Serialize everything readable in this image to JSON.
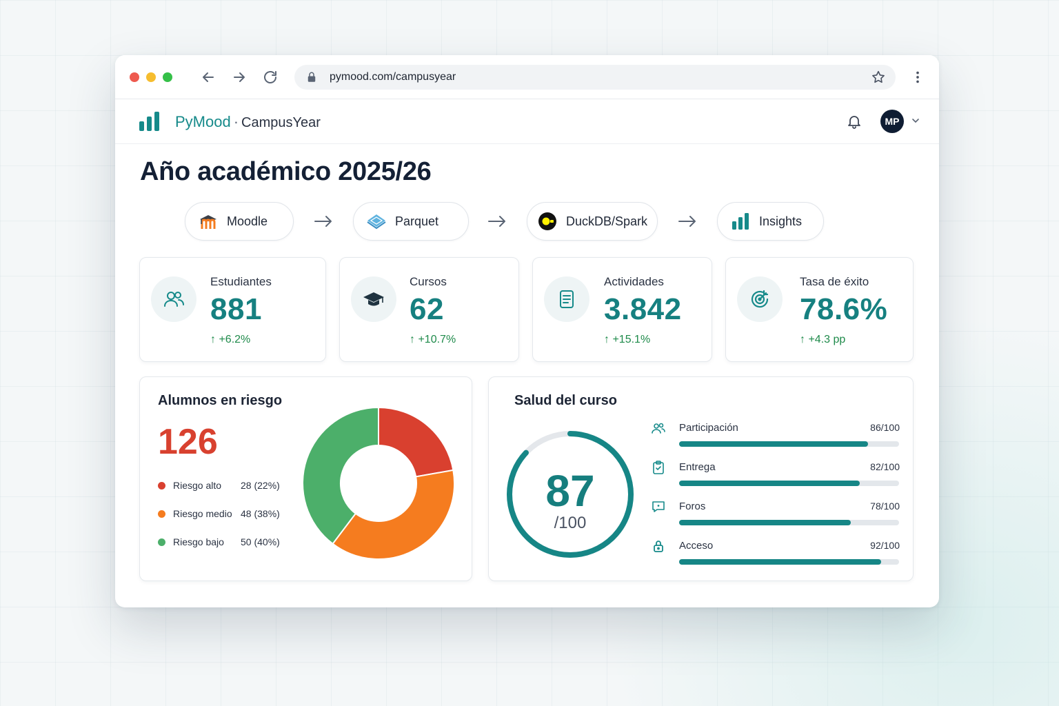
{
  "browser": {
    "url": "pymood.com/campusyear"
  },
  "app": {
    "brand_name": "PyMood",
    "brand_sep": "·",
    "brand_sub": "CampusYear",
    "user_initials": "MP"
  },
  "page": {
    "title": "Año académico 2025/26"
  },
  "pipeline": [
    {
      "label": "Moodle",
      "icon": "moodle-logo-icon"
    },
    {
      "label": "Parquet",
      "icon": "parquet-logo-icon"
    },
    {
      "label": "DuckDB/Spark",
      "icon": "duckdb-logo-icon"
    },
    {
      "label": "Insights",
      "icon": "bar-chart-icon"
    }
  ],
  "kpis": [
    {
      "label": "Estudiantes",
      "value": "881",
      "delta": "+6.2%",
      "icon": "users-icon"
    },
    {
      "label": "Cursos",
      "value": "62",
      "delta": "+10.7%",
      "icon": "graduation-cap-icon"
    },
    {
      "label": "Actividades",
      "value": "3.842",
      "delta": "+15.1%",
      "icon": "document-icon"
    },
    {
      "label": "Tasa de éxito",
      "value": "78.6%",
      "delta": "+4.3 pp",
      "icon": "target-icon"
    }
  ],
  "risk": {
    "title": "Alumnos en riesgo",
    "total": "126",
    "legend": [
      {
        "name": "Riesgo alto",
        "value": "28 (22%)",
        "color": "#d9402f"
      },
      {
        "name": "Riesgo medio",
        "value": "48 (38%)",
        "color": "#f57c1f"
      },
      {
        "name": "Riesgo bajo",
        "value": "50 (40%)",
        "color": "#4caf6a"
      }
    ]
  },
  "chart_data": {
    "type": "pie",
    "title": "Alumnos en riesgo",
    "categories": [
      "Riesgo alto",
      "Riesgo medio",
      "Riesgo bajo"
    ],
    "values": [
      28,
      48,
      50
    ],
    "colors": [
      "#d9402f",
      "#f57c1f",
      "#4caf6a"
    ]
  },
  "health": {
    "title": "Salud del curso",
    "score": "87",
    "denominator": "/100",
    "score_fraction": 0.87,
    "metrics": [
      {
        "name": "Participación",
        "score": "86/100",
        "value": 86,
        "icon": "people-icon"
      },
      {
        "name": "Entrega",
        "score": "82/100",
        "value": 82,
        "icon": "clipboard-check-icon"
      },
      {
        "name": "Foros",
        "score": "78/100",
        "value": 78,
        "icon": "chat-bubble-icon"
      },
      {
        "name": "Acceso",
        "score": "92/100",
        "value": 92,
        "icon": "lock-icon"
      }
    ]
  },
  "colors": {
    "accent": "#168a8a",
    "danger": "#d8412f",
    "positive": "#1e8a4a"
  }
}
